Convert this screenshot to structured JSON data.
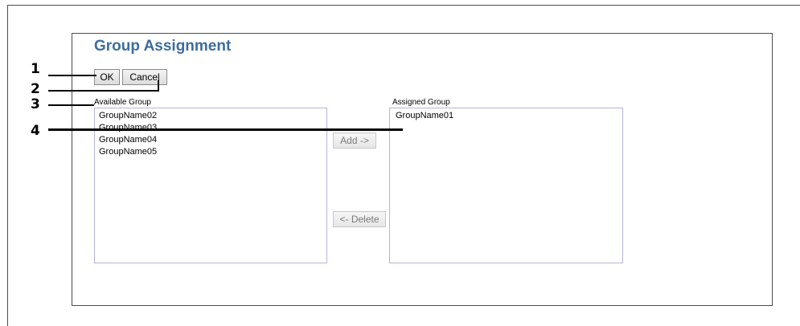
{
  "page": {
    "title": "Group Assignment"
  },
  "buttons": {
    "ok": "OK",
    "cancel": "Cancel",
    "add": "Add ->",
    "delete": "<- Delete"
  },
  "available": {
    "label": "Available Group",
    "items": [
      "GroupName02",
      "GroupName03",
      "GroupName04",
      "GroupName05"
    ]
  },
  "assigned": {
    "label": "Assigned Group",
    "items": [
      "GroupName01"
    ]
  },
  "callouts": [
    "1",
    "2",
    "3",
    "4"
  ],
  "colors": {
    "title": "#3d6d9e",
    "listbox_border": "#b4b4d8"
  }
}
